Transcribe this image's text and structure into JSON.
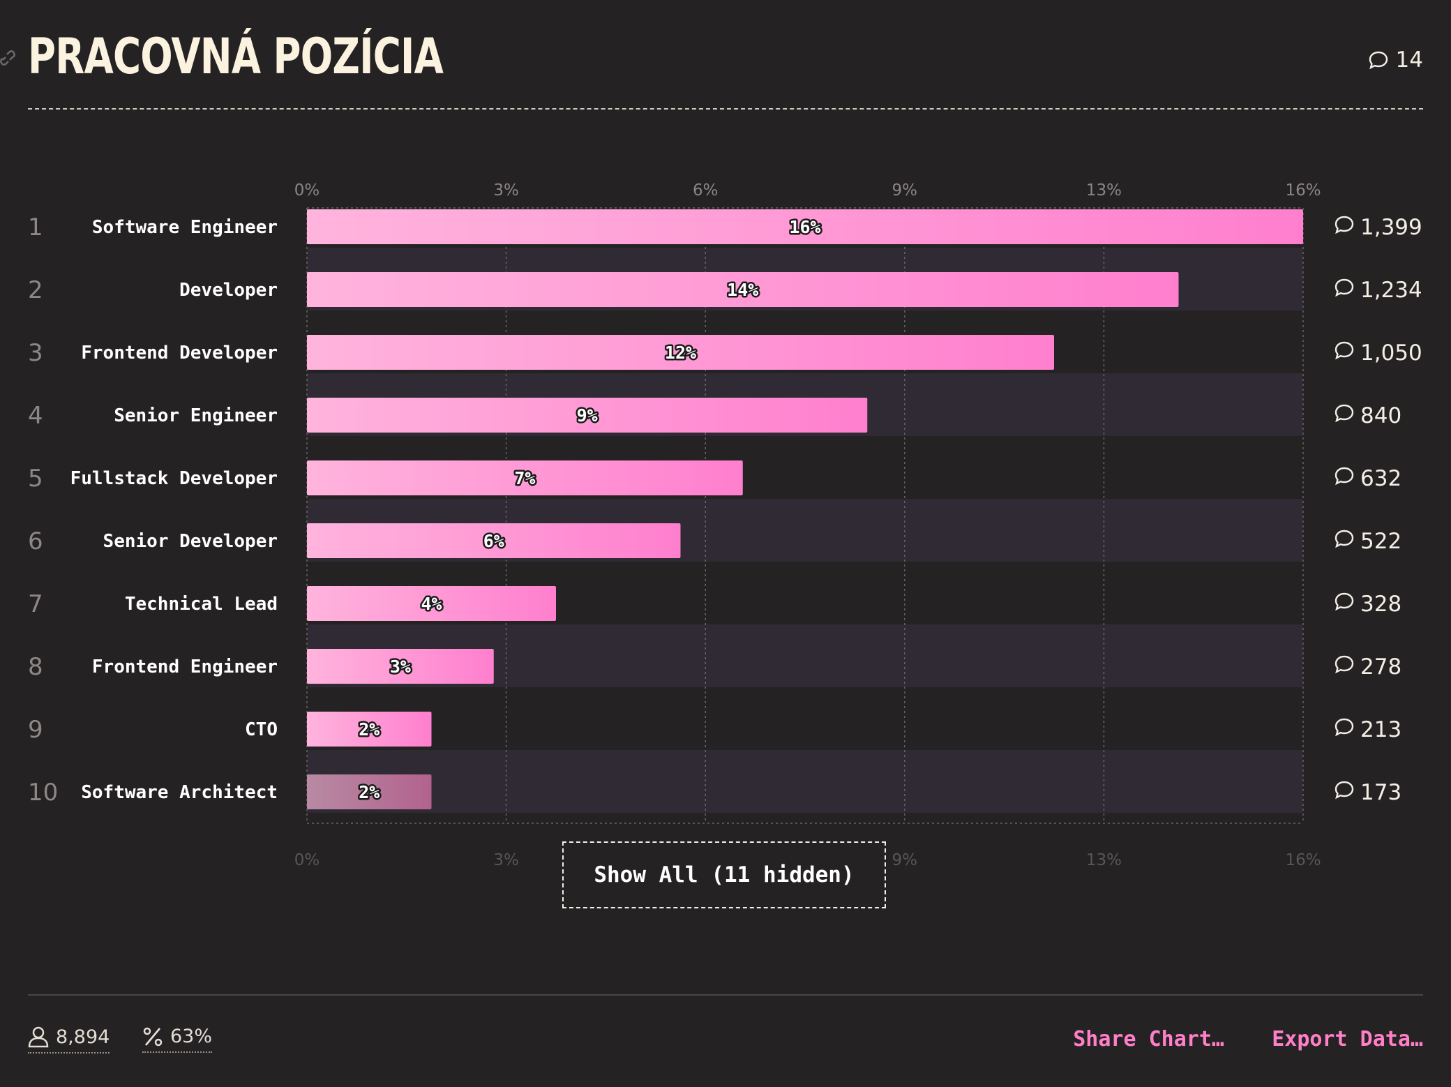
{
  "header": {
    "title": "PRACOVNÁ POZÍCIA",
    "comment_count": "14",
    "link_icon": "link-icon",
    "comment_icon": "speech-bubble-icon"
  },
  "chart_data": {
    "type": "bar",
    "orientation": "horizontal",
    "ranks": [
      "1",
      "2",
      "3",
      "4",
      "5",
      "6",
      "7",
      "8",
      "9",
      "10"
    ],
    "categories": [
      "Software Engineer",
      "Developer",
      "Frontend Developer",
      "Senior Engineer",
      "Fullstack Developer",
      "Senior Developer",
      "Technical Lead",
      "Frontend Engineer",
      "CTO",
      "Software Architect"
    ],
    "values": [
      16,
      14,
      12,
      9,
      7,
      6,
      4,
      3,
      2,
      2
    ],
    "value_labels": [
      "16%",
      "14%",
      "12%",
      "9%",
      "7%",
      "6%",
      "4%",
      "3%",
      "2%",
      "2%"
    ],
    "counts": [
      "1,399",
      "1,234",
      "1,050",
      "840",
      "632",
      "522",
      "328",
      "278",
      "213",
      "173"
    ],
    "x_ticks": [
      "0%",
      "3%",
      "6%",
      "9%",
      "13%",
      "16%"
    ],
    "xlim": [
      0,
      16
    ],
    "grid": true,
    "bar_colors": [
      "#ffb4dd",
      "#ff7fce"
    ],
    "highlight_last": false
  },
  "show_all_label": "Show All (11 hidden)",
  "footer": {
    "respondents": "8,894",
    "percentage": "63%",
    "share_label": "Share Chart…",
    "export_label": "Export Data…",
    "user_icon": "user-icon",
    "percent_icon": "percent-icon"
  }
}
